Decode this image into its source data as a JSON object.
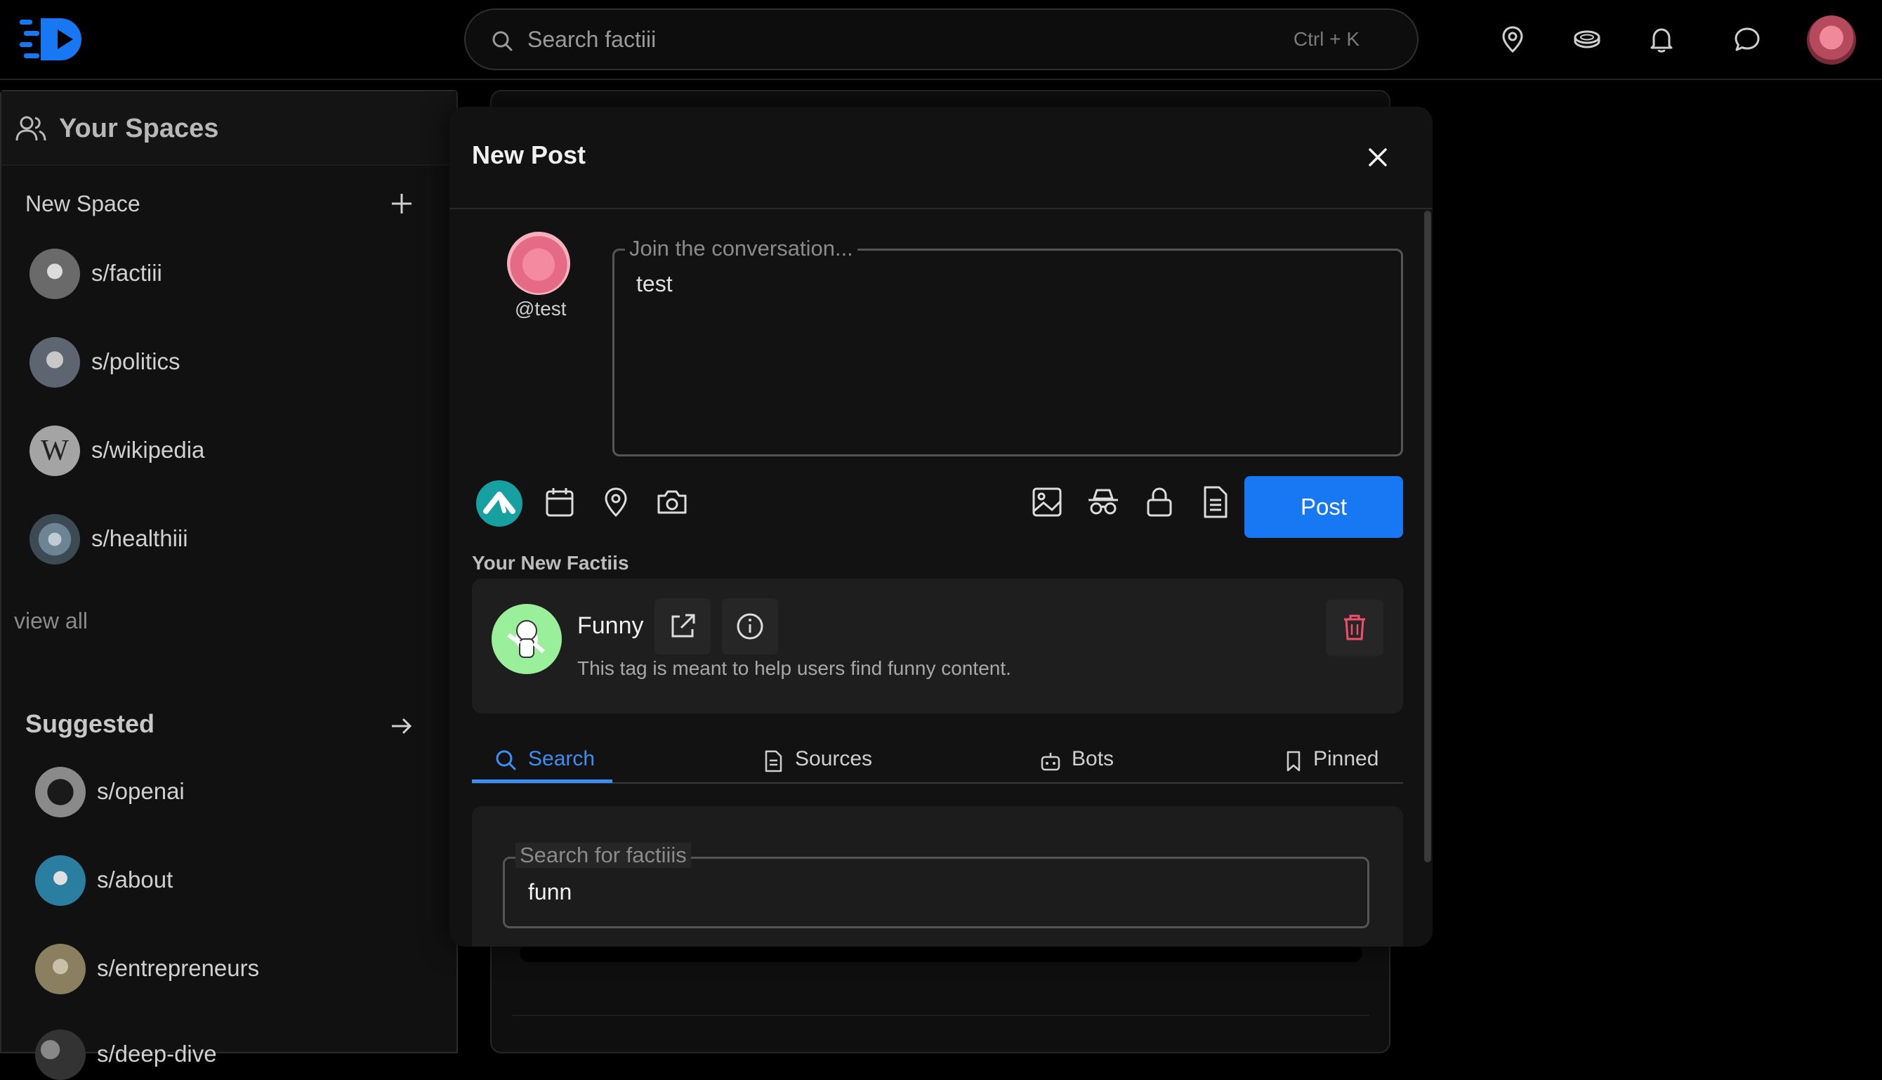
{
  "header": {
    "search_placeholder": "Search factiii",
    "search_shortcut": "Ctrl + K",
    "icons": [
      "location-icon",
      "coin-icon",
      "bell-icon",
      "chat-icon"
    ]
  },
  "sidebar": {
    "title": "Your Spaces",
    "new_space_label": "New Space",
    "spaces": [
      {
        "label": "s/factiii",
        "color": "#6a6a6a"
      },
      {
        "label": "s/politics",
        "color": "#5c6570"
      },
      {
        "label": "s/wikipedia",
        "color": "#9a9a9a",
        "initial": "W"
      },
      {
        "label": "s/healthiii",
        "color": "#4a5a66"
      }
    ],
    "view_all": "view all",
    "suggested_title": "Suggested",
    "suggested": [
      {
        "label": "s/openai",
        "color": "#777777"
      },
      {
        "label": "s/about",
        "color": "#2a7fa0"
      },
      {
        "label": "s/entrepreneurs",
        "color": "#8a8060"
      },
      {
        "label": "s/deep-dive",
        "color": "#333333"
      }
    ]
  },
  "modal": {
    "title": "New Post",
    "user_handle": "@test",
    "composer_label": "Join the conversation...",
    "composer_value": "test",
    "post_button": "Post",
    "factiis_title": "Your New Factiis",
    "factii": {
      "name": "Funny",
      "description": "This tag is meant to help users find funny content."
    },
    "tabs": [
      "Search",
      "Sources",
      "Bots",
      "Pinned"
    ],
    "active_tab": "Search",
    "search_label": "Search for factiiis",
    "search_value": "funn"
  },
  "colors": {
    "accent": "#1877f2",
    "tab_active": "#3b8ff5",
    "delete": "#f0506e",
    "brand_teal": "#16a0a0"
  }
}
